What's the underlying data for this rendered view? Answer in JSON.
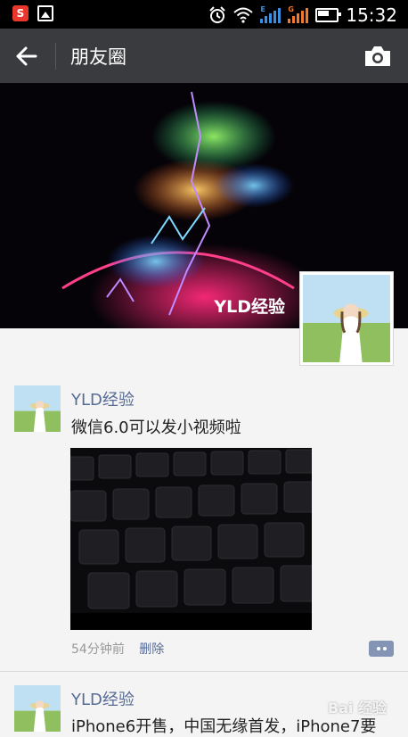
{
  "status_bar": {
    "time": "15:32",
    "signal_tag_1": "E",
    "signal_tag_2": "G",
    "icons": [
      "sogou-app-icon",
      "gallery-icon",
      "alarm-icon",
      "wifi-icon",
      "signal-icon",
      "battery-icon"
    ]
  },
  "header": {
    "title": "朋友圈",
    "back_icon": "arrow-left-icon",
    "camera_icon": "camera-icon"
  },
  "cover": {
    "display_name": "YLD经验"
  },
  "posts": [
    {
      "author": "YLD经验",
      "text": "微信6.0可以发小视频啦",
      "media": "video-keyboard",
      "time": "54分钟前",
      "delete_label": "删除"
    },
    {
      "author": "YLD经验",
      "text": "iPhone6开售，中国无缘首发，iPhone7要"
    }
  ],
  "watermark": "Bai 经验",
  "colors": {
    "statusbar_bg": "#000000",
    "titlebar_bg": "#3a3b3e",
    "link": "#576b95",
    "feed_bg": "#f4f4f4"
  }
}
